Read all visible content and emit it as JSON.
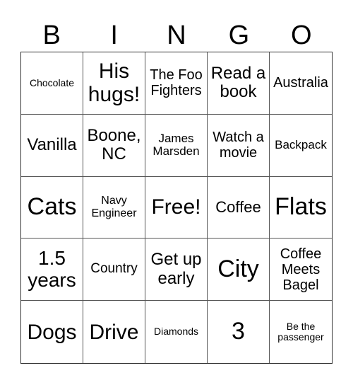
{
  "header": [
    "B",
    "I",
    "N",
    "G",
    "O"
  ],
  "cells": [
    [
      "Chocolate",
      "His hugs!",
      "The Foo Fighters",
      "Read a book",
      "Australia"
    ],
    [
      "Vanilla",
      "Boone, NC",
      "James Marsden",
      "Watch a movie",
      "Backpack"
    ],
    [
      "Cats",
      "Navy Engineer",
      "Free!",
      "Coffee",
      "Flats"
    ],
    [
      "1.5 years",
      "Country",
      "Get up early",
      "City",
      "Coffee Meets Bagel"
    ],
    [
      "Dogs",
      "Drive",
      "Diamonds",
      "3",
      "Be the passenger"
    ]
  ]
}
